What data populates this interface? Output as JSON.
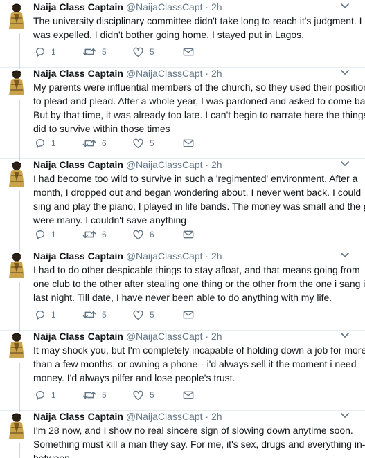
{
  "tweets": [
    {
      "name": "Naija Class Captain",
      "handle": "@NaijaClassCapt",
      "separator": "·",
      "time": "2h",
      "lines": [
        "The university disciplinary committee didn't take long to reach it's judgment. I",
        "was expelled. I didn't bother going home. I stayed put in Lagos."
      ],
      "replies": "1",
      "retweets": "5",
      "likes": "5"
    },
    {
      "name": "Naija Class Captain",
      "handle": "@NaijaClassCapt",
      "separator": "·",
      "time": "2h",
      "lines": [
        "My parents were influential members of the church, so they used their position",
        "to plead and plead. After a whole year, I was pardoned and asked to come back.",
        "But by that time, it was already too late. I can't begin to narrate here the things I",
        "did to survive within those times"
      ],
      "replies": "1",
      "retweets": "6",
      "likes": "5"
    },
    {
      "name": "Naija Class Captain",
      "handle": "@NaijaClassCapt",
      "separator": "·",
      "time": "2h",
      "lines": [
        "I had become too wild to survive in such a 'regimented' environment. After a",
        "month, I dropped out and began wondering about. I never went back. I could",
        "sing and play the piano, I played in life bands. The money was small and the girls",
        "were many. I couldn't save anything"
      ],
      "replies": "1",
      "retweets": "6",
      "likes": "6"
    },
    {
      "name": "Naija Class Captain",
      "handle": "@NaijaClassCapt",
      "separator": "·",
      "time": "2h",
      "lines": [
        "I had to do other despicable things to stay afloat, and that means going from",
        "one club to the other after stealing one thing or the other from the one i sang in",
        "last night. Till date, I have never been able to do anything with my life."
      ],
      "replies": "1",
      "retweets": "5",
      "likes": "5"
    },
    {
      "name": "Naija Class Captain",
      "handle": "@NaijaClassCapt",
      "separator": "·",
      "time": "2h",
      "lines": [
        "It may shock you, but I'm completely incapable of holding down a job for more",
        "than a few months, or owning a phone-- i'd always sell it the moment i need",
        "money. I'd always pilfer and lose people's trust."
      ],
      "replies": "1",
      "retweets": "5",
      "likes": "5"
    },
    {
      "name": "Naija Class Captain",
      "handle": "@NaijaClassCapt",
      "separator": "·",
      "time": "2h",
      "lines": [
        "I'm 28 now, and I show no real sincere sign of slowing down anytime soon.",
        "Something must kill a man they say. For me, it's sex, drugs and everything in-",
        "between."
      ],
      "replies": "",
      "retweets": "",
      "likes": ""
    }
  ],
  "colors": {
    "thread_line": "#ccd6dd",
    "icon_gray": "#657786",
    "text": "#14171a"
  }
}
